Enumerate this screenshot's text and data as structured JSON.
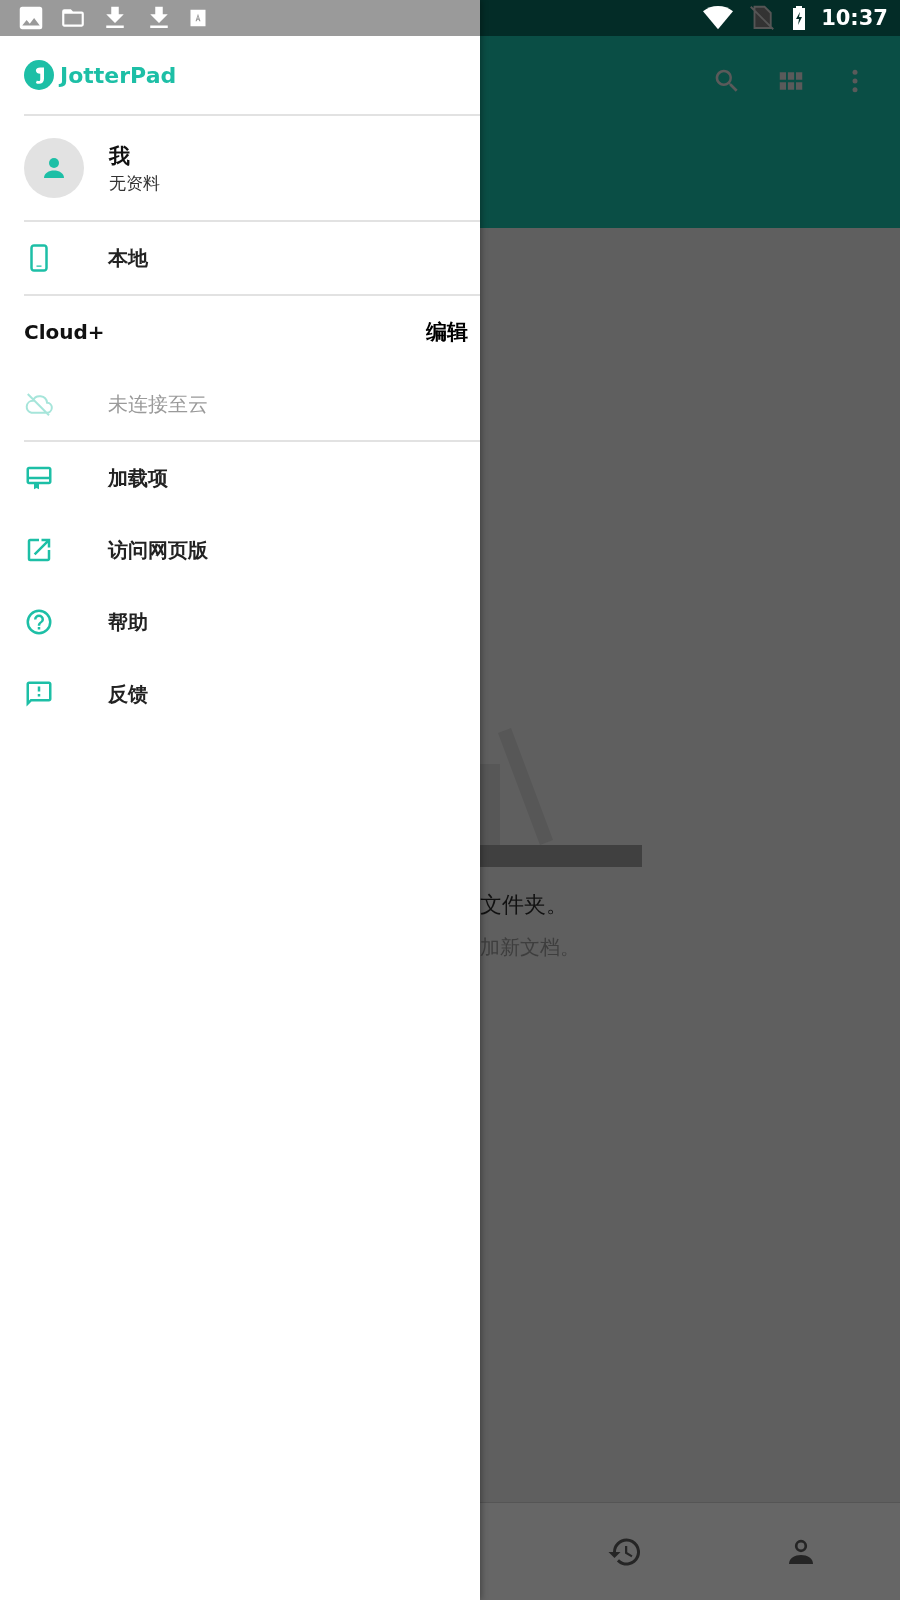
{
  "status_bar": {
    "time": "10:37"
  },
  "drawer": {
    "brand": "JotterPad",
    "profile": {
      "name": "我",
      "subtitle": "无资料"
    },
    "sections": [
      {
        "items": [
          {
            "label": "本地",
            "disabled": false
          }
        ]
      },
      {
        "header": "Cloud+",
        "action": "编辑",
        "items": [
          {
            "label": "未连接至云",
            "disabled": true
          }
        ]
      },
      {
        "items": [
          {
            "label": "加载项",
            "disabled": false
          },
          {
            "label": "访问网页版",
            "disabled": false
          },
          {
            "label": "帮助",
            "disabled": false
          },
          {
            "label": "反馈",
            "disabled": false
          }
        ]
      }
    ]
  },
  "background": {
    "empty_title": "文件夹。",
    "empty_hint": "加新文档。"
  }
}
